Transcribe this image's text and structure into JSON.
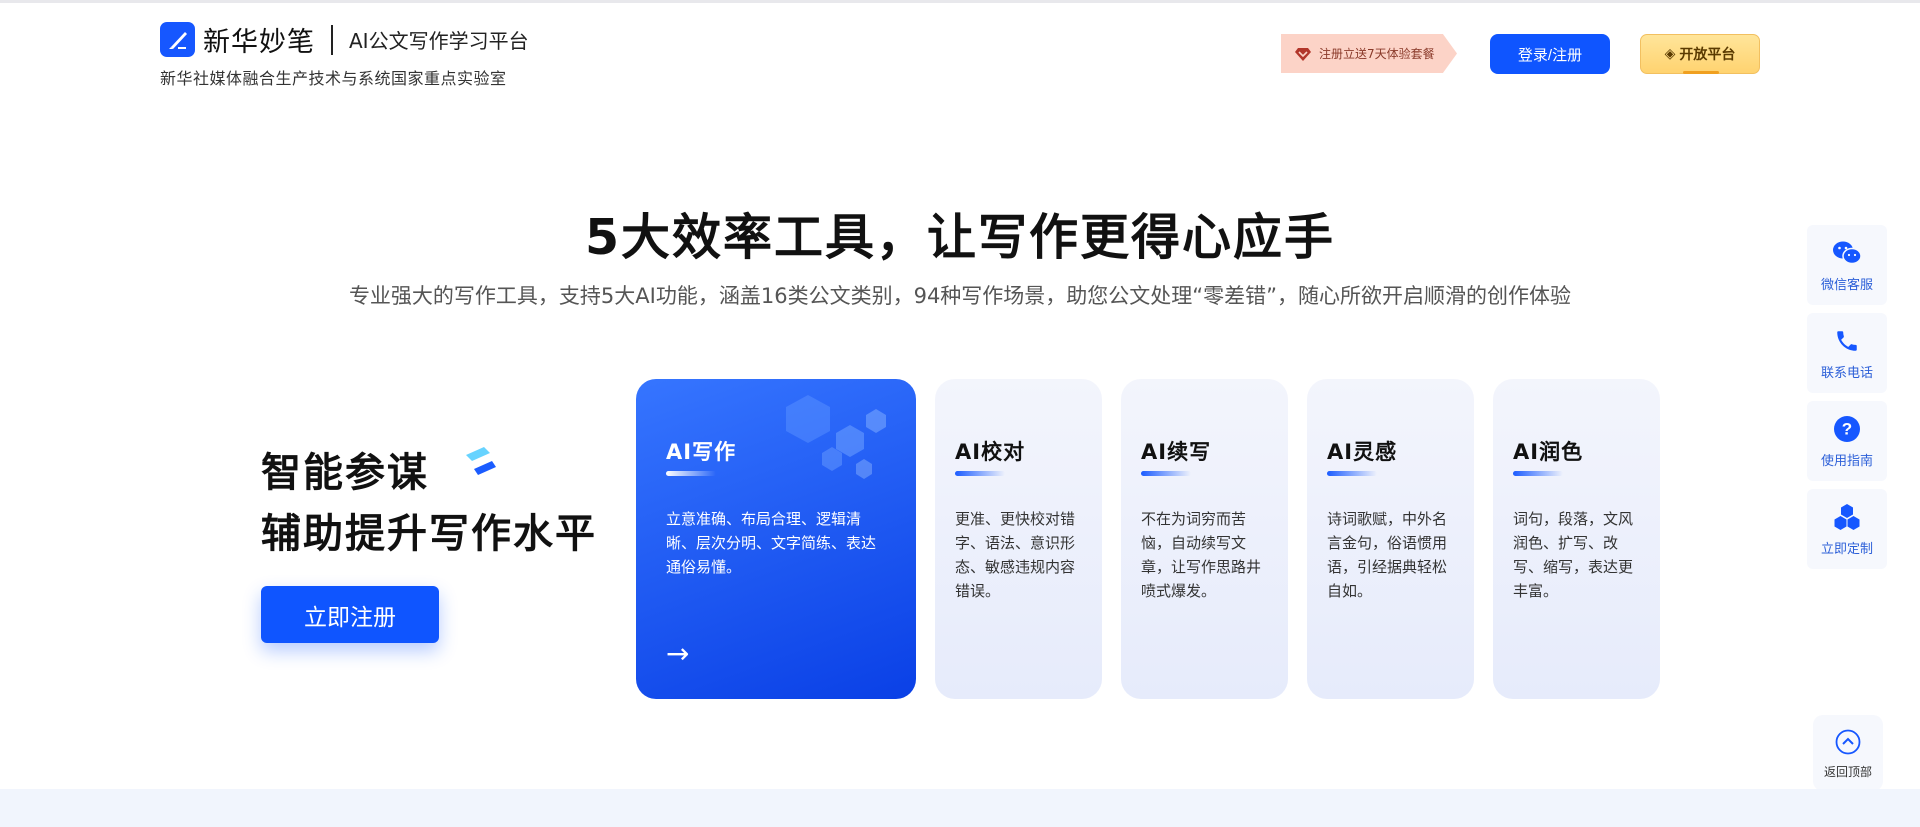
{
  "header": {
    "brand_name": "新华妙笔",
    "platform_name": "AI公文写作学习平台",
    "organization": "新华社媒体融合生产技术与系统国家重点实验室",
    "promo_label": "注册立送7天体验套餐",
    "login_label": "登录/注册",
    "open_platform_label": "开放平台"
  },
  "hero": {
    "title": "5大效率工具，让写作更得心应手",
    "subtitle": "专业强大的写作工具，支持5大AI功能，涵盖16类公文类别，94种写作场景，助您公文处理“零差错”，随心所欲开启顺滑的创作体验"
  },
  "left": {
    "line1": "智能参谋",
    "line2": "辅助提升写作水平",
    "register_label": "立即注册"
  },
  "cards": [
    {
      "title": "AI写作",
      "desc": "立意准确、布局合理、逻辑清晰、层次分明、文字简练、表达通俗易懂。",
      "arrow": "→"
    },
    {
      "title": "AI校对",
      "desc": "更准、更快校对错字、语法、意识形态、敏感违规内容错误。"
    },
    {
      "title": "AI续写",
      "desc": "不在为词穷而苦恼，自动续写文章，让写作思路井喷式爆发。"
    },
    {
      "title": "AI灵感",
      "desc": "诗词歌赋，中外名言金句，俗语惯用语，引经据典轻松自如。"
    },
    {
      "title": "AI润色",
      "desc": "词句，段落，文风润色、扩写、改写、缩写，表达更丰富。"
    }
  ],
  "sidebar": {
    "items": [
      {
        "label": "微信客服",
        "icon": "wechat-icon"
      },
      {
        "label": "联系电话",
        "icon": "phone-icon"
      },
      {
        "label": "使用指南",
        "icon": "help-icon"
      },
      {
        "label": "立即定制",
        "icon": "cubes-icon"
      }
    ],
    "back_top_label": "返回顶部"
  },
  "colors": {
    "primary": "#0f55ff",
    "card_bg": "#eef1fb",
    "promo_bg": "#fcd3c7",
    "open_platform_bg": "#ffd980"
  }
}
